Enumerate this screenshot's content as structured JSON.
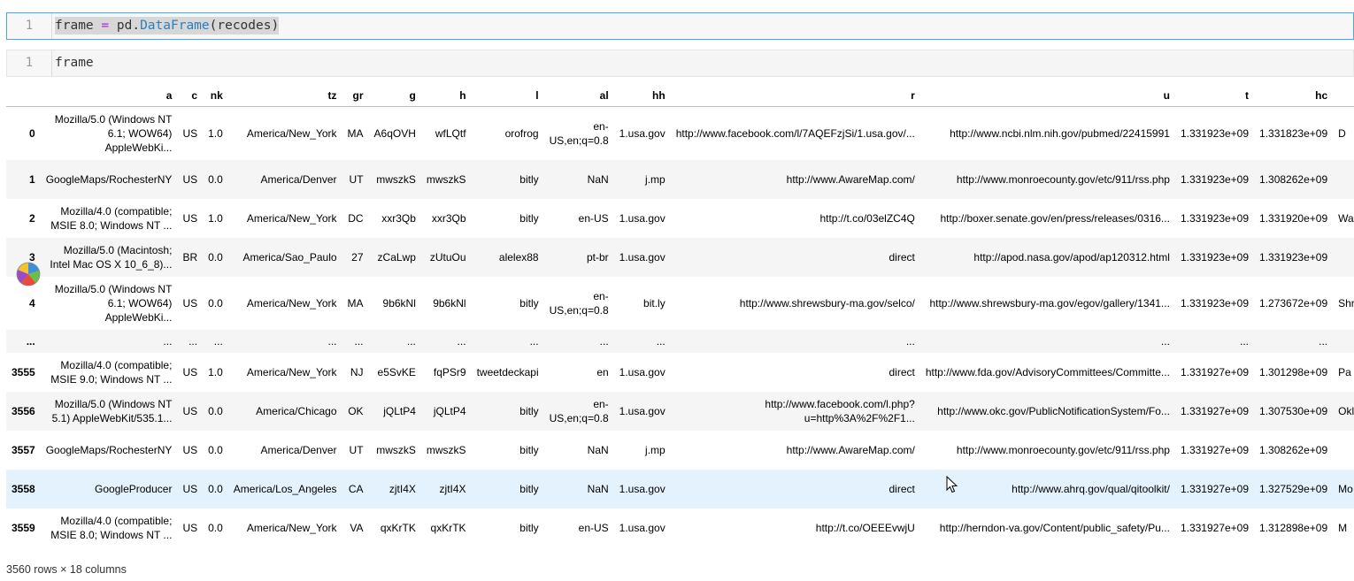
{
  "cells": [
    {
      "line_no": "1",
      "code_var": "frame",
      "code_op": "=",
      "code_mod": "pd.",
      "code_fn": "DataFrame",
      "code_args": "(recodes)"
    },
    {
      "line_no": "1",
      "code": "frame"
    }
  ],
  "table": {
    "columns": [
      "",
      "a",
      "c",
      "nk",
      "tz",
      "gr",
      "g",
      "h",
      "l",
      "al",
      "hh",
      "r",
      "u",
      "t",
      "hc",
      ""
    ],
    "rows": [
      {
        "index": "0",
        "a": "Mozilla/5.0 (Windows NT 6.1; WOW64) AppleWebKi...",
        "c": "US",
        "nk": "1.0",
        "tz": "America/New_York",
        "gr": "MA",
        "g": "A6qOVH",
        "h": "wfLQtf",
        "l": "orofrog",
        "al": "en-US,en;q=0.8",
        "hh": "1.usa.gov",
        "r": "http://www.facebook.com/l/7AQEFzjSi/1.usa.gov/...",
        "u": "http://www.ncbi.nlm.nih.gov/pubmed/22415991",
        "t": "1.331923e+09",
        "hc": "1.331823e+09",
        "extra": "D"
      },
      {
        "index": "1",
        "a": "GoogleMaps/RochesterNY",
        "c": "US",
        "nk": "0.0",
        "tz": "America/Denver",
        "gr": "UT",
        "g": "mwszkS",
        "h": "mwszkS",
        "l": "bitly",
        "al": "NaN",
        "hh": "j.mp",
        "r": "http://www.AwareMap.com/",
        "u": "http://www.monroecounty.gov/etc/911/rss.php",
        "t": "1.331923e+09",
        "hc": "1.308262e+09",
        "extra": ""
      },
      {
        "index": "2",
        "a": "Mozilla/4.0 (compatible; MSIE 8.0; Windows NT ...",
        "c": "US",
        "nk": "1.0",
        "tz": "America/New_York",
        "gr": "DC",
        "g": "xxr3Qb",
        "h": "xxr3Qb",
        "l": "bitly",
        "al": "en-US",
        "hh": "1.usa.gov",
        "r": "http://t.co/03elZC4Q",
        "u": "http://boxer.senate.gov/en/press/releases/0316...",
        "t": "1.331923e+09",
        "hc": "1.331920e+09",
        "extra": "Wash"
      },
      {
        "index": "3",
        "a": "Mozilla/5.0 (Macintosh; Intel Mac OS X 10_6_8)...",
        "c": "BR",
        "nk": "0.0",
        "tz": "America/Sao_Paulo",
        "gr": "27",
        "g": "zCaLwp",
        "h": "zUtuOu",
        "l": "alelex88",
        "al": "pt-br",
        "hh": "1.usa.gov",
        "r": "direct",
        "u": "http://apod.nasa.gov/apod/ap120312.html",
        "t": "1.331923e+09",
        "hc": "1.331923e+09",
        "extra": ""
      },
      {
        "index": "4",
        "a": "Mozilla/5.0 (Windows NT 6.1; WOW64) AppleWebKi...",
        "c": "US",
        "nk": "0.0",
        "tz": "America/New_York",
        "gr": "MA",
        "g": "9b6kNl",
        "h": "9b6kNl",
        "l": "bitly",
        "al": "en-US,en;q=0.8",
        "hh": "bit.ly",
        "r": "http://www.shrewsbury-ma.gov/selco/",
        "u": "http://www.shrewsbury-ma.gov/egov/gallery/1341...",
        "t": "1.331923e+09",
        "hc": "1.273672e+09",
        "extra": "Shrev"
      },
      {
        "index": "...",
        "a": "...",
        "c": "...",
        "nk": "...",
        "tz": "...",
        "gr": "...",
        "g": "...",
        "h": "...",
        "l": "...",
        "al": "...",
        "hh": "...",
        "r": "...",
        "u": "...",
        "t": "...",
        "hc": "...",
        "extra": ""
      },
      {
        "index": "3555",
        "a": "Mozilla/4.0 (compatible; MSIE 9.0; Windows NT ...",
        "c": "US",
        "nk": "1.0",
        "tz": "America/New_York",
        "gr": "NJ",
        "g": "e5SvKE",
        "h": "fqPSr9",
        "l": "tweetdeckapi",
        "al": "en",
        "hh": "1.usa.gov",
        "r": "direct",
        "u": "http://www.fda.gov/AdvisoryCommittees/Committe...",
        "t": "1.331927e+09",
        "hc": "1.301298e+09",
        "extra": "Pa"
      },
      {
        "index": "3556",
        "a": "Mozilla/5.0 (Windows NT 5.1) AppleWebKit/535.1...",
        "c": "US",
        "nk": "0.0",
        "tz": "America/Chicago",
        "gr": "OK",
        "g": "jQLtP4",
        "h": "jQLtP4",
        "l": "bitly",
        "al": "en-US,en;q=0.8",
        "hh": "1.usa.gov",
        "r": "http://www.facebook.com/l.php?u=http%3A%2F%2F1...",
        "u": "http://www.okc.gov/PublicNotificationSystem/Fo...",
        "t": "1.331927e+09",
        "hc": "1.307530e+09",
        "extra": "Okla"
      },
      {
        "index": "3557",
        "a": "GoogleMaps/RochesterNY",
        "c": "US",
        "nk": "0.0",
        "tz": "America/Denver",
        "gr": "UT",
        "g": "mwszkS",
        "h": "mwszkS",
        "l": "bitly",
        "al": "NaN",
        "hh": "j.mp",
        "r": "http://www.AwareMap.com/",
        "u": "http://www.monroecounty.gov/etc/911/rss.php",
        "t": "1.331927e+09",
        "hc": "1.308262e+09",
        "extra": ""
      },
      {
        "index": "3558",
        "a": "GoogleProducer",
        "c": "US",
        "nk": "0.0",
        "tz": "America/Los_Angeles",
        "gr": "CA",
        "g": "zjtI4X",
        "h": "zjtI4X",
        "l": "bitly",
        "al": "NaN",
        "hh": "1.usa.gov",
        "r": "direct",
        "u": "http://www.ahrq.gov/qual/qitoolkit/",
        "t": "1.331927e+09",
        "hc": "1.327529e+09",
        "extra": "Mo"
      },
      {
        "index": "3559",
        "a": "Mozilla/4.0 (compatible; MSIE 8.0; Windows NT ...",
        "c": "US",
        "nk": "0.0",
        "tz": "America/New_York",
        "gr": "VA",
        "g": "qxKrTK",
        "h": "qxKrTK",
        "l": "bitly",
        "al": "en-US",
        "hh": "1.usa.gov",
        "r": "http://t.co/OEEEvwjU",
        "u": "http://herndon-va.gov/Content/public_safety/Pu...",
        "t": "1.331927e+09",
        "hc": "1.312898e+09",
        "extra": "M"
      }
    ]
  },
  "footer": "3560 rows × 18 columns",
  "icons": {
    "cursor": "mouse-cursor-icon",
    "loading": "beach-ball-icon"
  }
}
